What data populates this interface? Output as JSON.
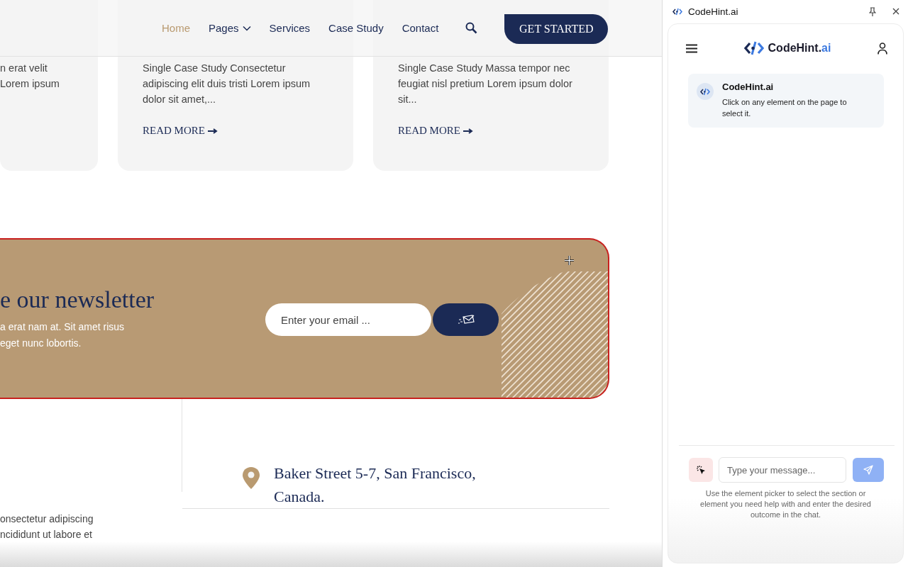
{
  "nav": {
    "items": [
      {
        "label": "Home",
        "selected": true,
        "dropdown": false
      },
      {
        "label": "Pages",
        "selected": false,
        "dropdown": true
      },
      {
        "label": "Services",
        "selected": false,
        "dropdown": false
      },
      {
        "label": "Case Study",
        "selected": false,
        "dropdown": false
      },
      {
        "label": "Contact",
        "selected": false,
        "dropdown": false
      }
    ],
    "cta": "GET STARTED"
  },
  "cards": [
    {
      "body": "n erat velit\nLorem ipsum"
    },
    {
      "body": "Single Case Study Consectetur\nadipiscing elit duis tristi Lorem ipsum\ndolor sit amet,...",
      "link": "READ MORE"
    },
    {
      "body": "Single Case Study Massa tempor nec\nfeugiat nisl pretium Lorem ipsum dolor\nsit...",
      "link": "READ MORE"
    }
  ],
  "newsletter": {
    "title": "e our newsletter",
    "text": "a erat nam at. Sit amet risus\n eget nunc lobortis.",
    "email_placeholder": "Enter your email ..."
  },
  "footer": {
    "left_text": "onsectetur adipiscing\nncididunt ut labore et",
    "address": "Baker Street 5-7, San Francisco,\nCanada."
  },
  "assistant": {
    "window_title": "CodeHint.ai",
    "logo_text": "CodeHint.",
    "logo_suffix": "ai",
    "message": {
      "sender": "CodeHint.ai",
      "text": "Click on any element on the page to select it."
    },
    "input_placeholder": "Type your message...",
    "hint": "Use the element picker to select the section or element you need help with and enter the desired outcome in the chat."
  }
}
